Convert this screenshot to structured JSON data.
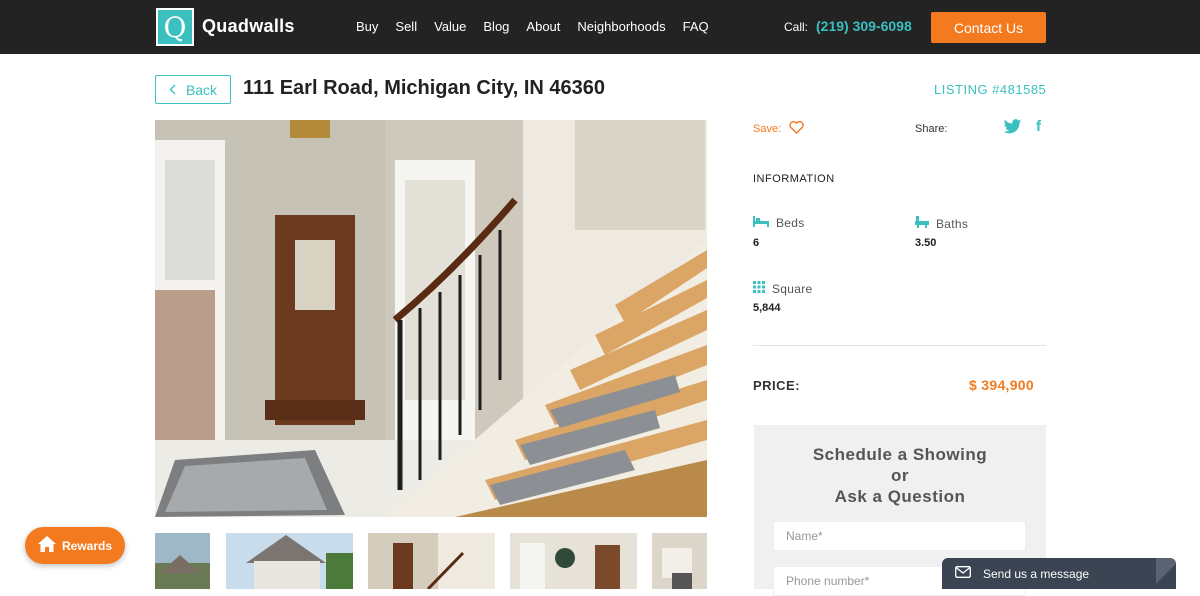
{
  "header": {
    "logo_letter": "Q",
    "brand": "Quadwalls",
    "nav": [
      "Buy",
      "Sell",
      "Value",
      "Blog",
      "About",
      "Neighborhoods",
      "FAQ"
    ],
    "call_label": "Call:",
    "phone": "(219) 309-6098",
    "contact_button": "Contact Us"
  },
  "listing": {
    "back_label": "Back",
    "address": "111 Earl Road, Michigan City, IN 46360",
    "listing_number": "LISTING #481585"
  },
  "sidebar": {
    "save_label": "Save:",
    "share_label": "Share:",
    "information_heading": "INFORMATION",
    "beds_label": "Beds",
    "beds_value": "6",
    "baths_label": "Baths",
    "baths_value": "3.50",
    "square_label": "Square",
    "square_value": "5,844",
    "price_label": "PRICE:",
    "price_value": "$ 394,900"
  },
  "schedule": {
    "title_line1": "Schedule a Showing",
    "title_line2": "or",
    "title_line3": "Ask a Question",
    "name_placeholder": "Name*",
    "phone_placeholder": "Phone number*"
  },
  "widgets": {
    "rewards_label": "Rewards",
    "message_label": "Send us a message"
  },
  "colors": {
    "accent": "#3bbfbf",
    "brand_orange": "#f47a20",
    "header_bg": "#232323"
  }
}
